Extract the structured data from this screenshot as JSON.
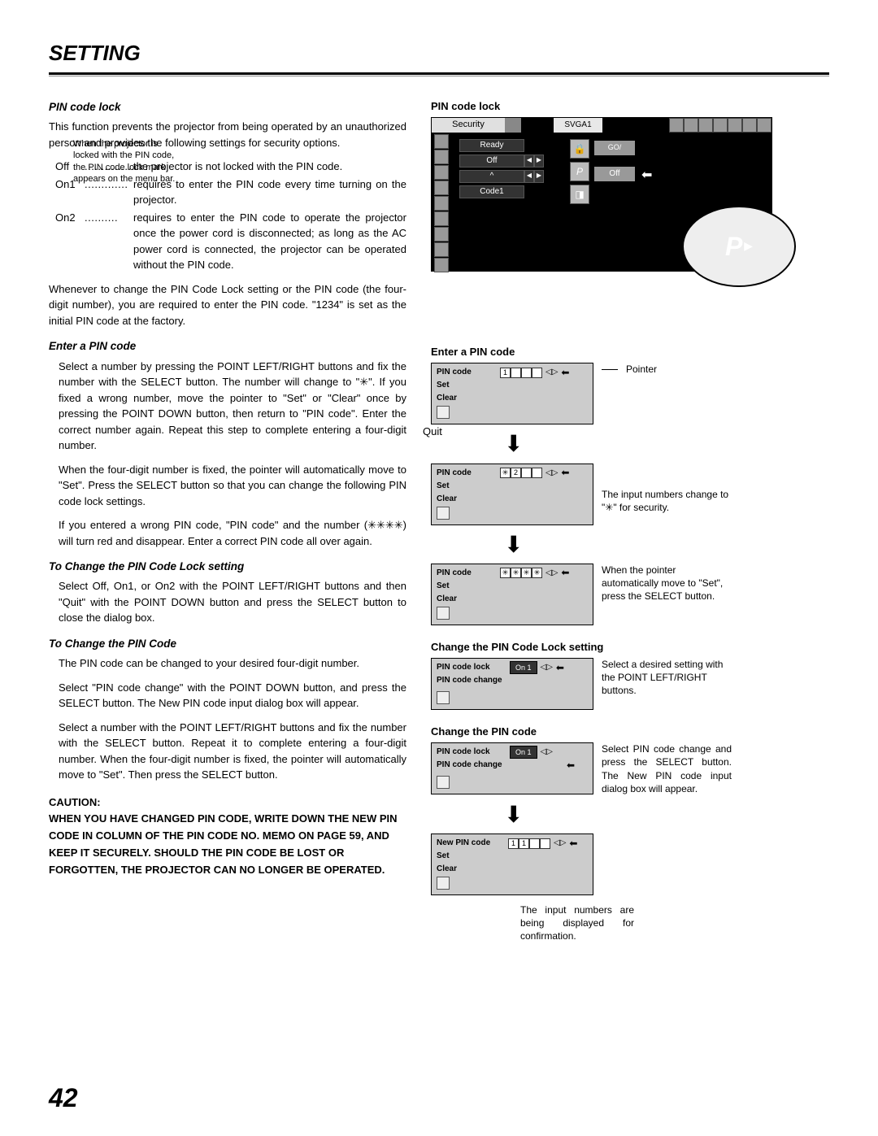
{
  "page": {
    "title": "SETTING",
    "number": "42"
  },
  "left": {
    "sec1_title": "PIN code lock",
    "sec1_intro": "This function prevents the projector from being operated by an unauthorized person and provides the following settings for security options.",
    "opt_off_label": "Off",
    "opt_off_dots": "...............",
    "opt_off_text": "the projector is not locked with the PIN code.",
    "opt_on1_label": "On1",
    "opt_on1_dots": ".............",
    "opt_on1_text": "requires to enter the PIN code every time turning on the projector.",
    "opt_on2_label": "On2",
    "opt_on2_dots": "..........",
    "opt_on2_text": "requires to enter the PIN code to operate the projector once the power cord is disconnected; as long as the AC power cord is connected, the projector can be operated without the PIN code.",
    "sec1_p2": "Whenever to change the PIN Code Lock setting or the PIN code (the four-digit number), you are required to enter the PIN code. \"1234\" is set as the initial PIN code at the factory.",
    "sec2_title": "Enter a PIN code",
    "sec2_p1": "Select a number by pressing the POINT LEFT/RIGHT buttons and fix the number with the SELECT button.  The number will change to \"✳\".  If you fixed a wrong number, move the pointer to \"Set\" or \"Clear\" once by pressing the POINT DOWN button, then return to \"PIN code\".  Enter the correct number again. Repeat this step to complete entering a four-digit number.",
    "sec2_p2": "When the four-digit number is fixed, the pointer will automatically move to \"Set\".  Press the SELECT button so that you can change the following PIN code lock settings.",
    "sec2_p3": "If you entered a wrong PIN code, \"PIN code\" and the number (✳✳✳✳) will turn red and disappear.  Enter a correct PIN code all over again.",
    "sec3_title": "To Change the PIN Code Lock setting",
    "sec3_p1": "Select Off, On1, or On2 with the POINT LEFT/RIGHT buttons and then   \"Quit\" with the POINT DOWN button and press the SELECT button to close the dialog box.",
    "sec4_title": "To Change the PIN Code",
    "sec4_p1": "The PIN code can be changed to your desired four-digit number.",
    "sec4_p2": "Select \"PIN code change\" with the POINT DOWN button, and press the SELECT button.  The New PIN code input dialog box will appear.",
    "sec4_p3": "Select a number with the POINT LEFT/RIGHT buttons and fix the number with the SELECT button. Repeat it to complete entering a four-digit number.  When the four-digit number is fixed, the pointer will automatically move to \"Set\".  Then press the SELECT button.",
    "caution_title": "CAUTION:",
    "caution_body": "WHEN YOU HAVE CHANGED PIN CODE, WRITE DOWN THE NEW PIN CODE IN COLUMN OF THE PIN CODE NO. MEMO ON PAGE 59, AND KEEP IT SECURELY.  SHOULD THE PIN CODE BE LOST OR FORGOTTEN, THE PROJECTOR CAN NO LONGER BE OPERATED."
  },
  "right": {
    "pin_lock_heading": "PIN code lock",
    "menu_security": "Security",
    "menu_svga": "SVGA1",
    "menu_ready": "Ready",
    "menu_off_row": "Off",
    "menu_lamp": "^",
    "menu_code1": "Code1",
    "menu_off_big": "Off",
    "menu_zoom_p": "P",
    "menu_note": "When the projector is locked with the PIN code,  the PIN code lock mark appears on the menu bar.",
    "enter_pin_heading": "Enter a PIN code",
    "pointer_label": "Pointer",
    "pin_label": "PIN code",
    "set_label": "Set",
    "clear_label": "Clear",
    "quit_label": "Quit",
    "box1_digit": "1",
    "box2_star": "✳",
    "box2_digit": "2",
    "boxes_stars": "✳",
    "ann_input_change": "The input numbers change to \"✳\" for security.",
    "ann_pointer_move": "When the pointer automatically move to \"Set\", press the SELECT button.",
    "change_setting_heading": "Change the PIN Code Lock setting",
    "pin_code_lock_label": "PIN code lock",
    "pin_code_change_label": "PIN code change",
    "on1_label": "On 1",
    "ann_select_desired": "Select a desired setting with the POINT LEFT/RIGHT buttons.",
    "change_pin_heading": "Change the PIN code",
    "ann_select_pin_change": "Select PIN code change and press the SELECT button. The New PIN code input dialog box will appear.",
    "new_pin_label": "New PIN code",
    "new_pin_d1": "1",
    "new_pin_d2": "1",
    "ann_display_confirm": "The input numbers are being displayed for confirmation."
  }
}
